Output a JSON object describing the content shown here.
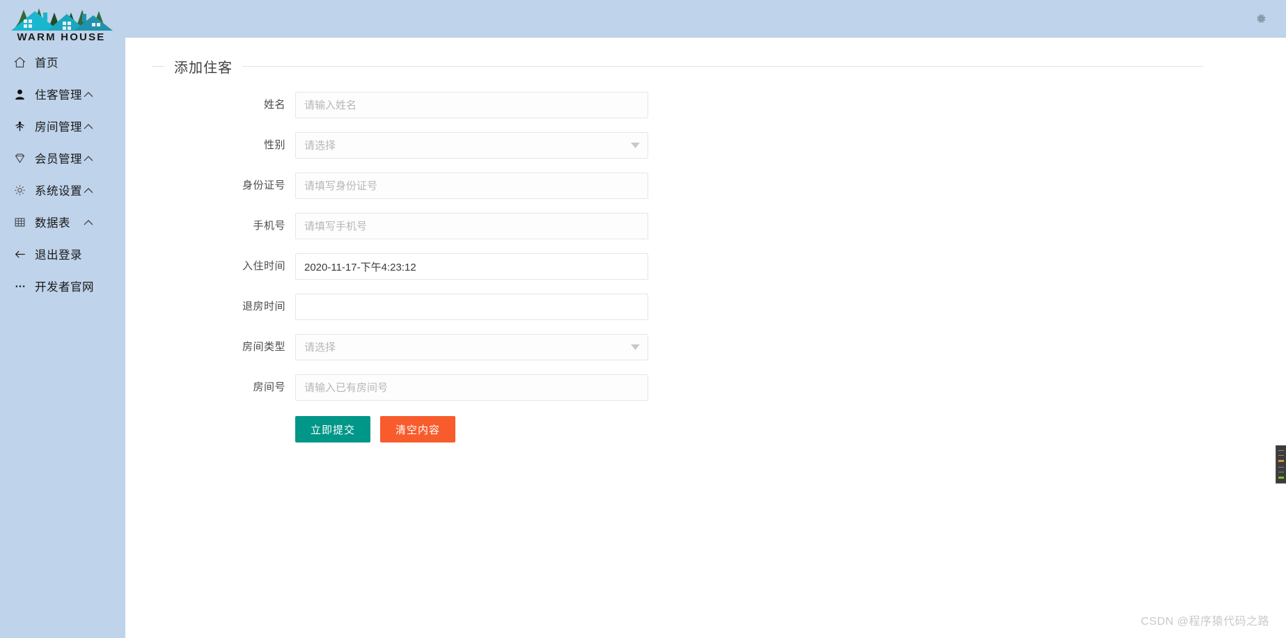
{
  "brand": {
    "name": "WARM HOUSE",
    "logo_alt": "warm-house-logo"
  },
  "sidebar": {
    "items": [
      {
        "label": "首页",
        "icon": "home-icon",
        "has_caret": false
      },
      {
        "label": "住客管理",
        "icon": "user-icon",
        "has_caret": true
      },
      {
        "label": "房间管理",
        "icon": "tree-icon",
        "has_caret": true
      },
      {
        "label": "会员管理",
        "icon": "diamond-icon",
        "has_caret": true
      },
      {
        "label": "系统设置",
        "icon": "gear-icon",
        "has_caret": true
      },
      {
        "label": "数据表",
        "icon": "table-icon",
        "has_caret": true
      },
      {
        "label": "退出登录",
        "icon": "arrow-left-icon",
        "has_caret": false
      },
      {
        "label": "开发者官网",
        "icon": "ellipsis-icon",
        "has_caret": false
      }
    ]
  },
  "topbar": {
    "settings_icon": "gear-icon"
  },
  "panel": {
    "title": "添加住客"
  },
  "form": {
    "fields": [
      {
        "label": "姓名",
        "type": "text",
        "value": "",
        "placeholder": "请输入姓名",
        "name": "guest-name"
      },
      {
        "label": "性别",
        "type": "select",
        "value": "",
        "placeholder": "请选择",
        "name": "guest-gender"
      },
      {
        "label": "身份证号",
        "type": "text",
        "value": "",
        "placeholder": "请填写身份证号",
        "name": "guest-id-card"
      },
      {
        "label": "手机号",
        "type": "text",
        "value": "",
        "placeholder": "请填写手机号",
        "name": "guest-phone"
      },
      {
        "label": "入住时间",
        "type": "text",
        "value": "2020-11-17-下午4:23:12",
        "placeholder": "",
        "name": "check-in-time"
      },
      {
        "label": "退房时间",
        "type": "text",
        "value": "",
        "placeholder": "",
        "name": "check-out-time"
      },
      {
        "label": "房间类型",
        "type": "select",
        "value": "",
        "placeholder": "请选择",
        "name": "room-type"
      },
      {
        "label": "房间号",
        "type": "text",
        "value": "",
        "placeholder": "请输入已有房间号",
        "name": "room-number"
      }
    ],
    "submit_label": "立即提交",
    "clear_label": "清空内容"
  },
  "watermark": {
    "text": "CSDN @程序猿代码之路"
  },
  "colors": {
    "sidebar_bg": "#bfd3ea",
    "submit": "#009688",
    "clear": "#f85c2c",
    "text": "#1a1a1a"
  }
}
